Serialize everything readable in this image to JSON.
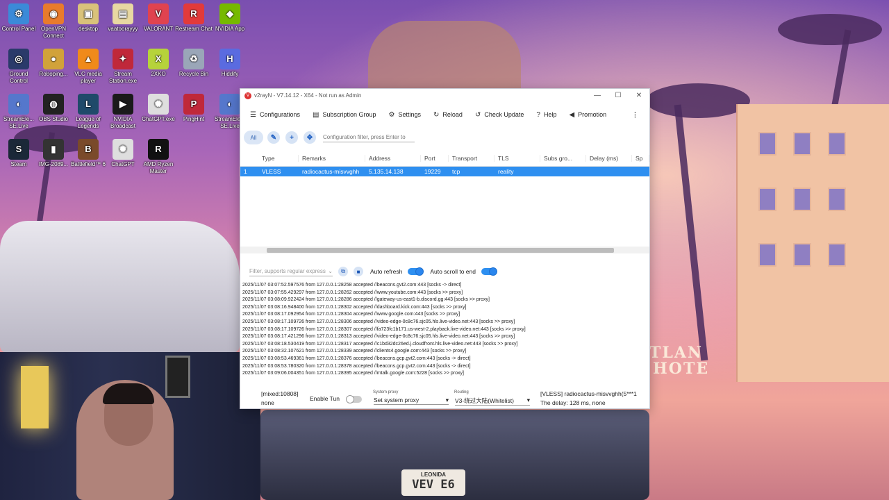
{
  "desktop_icons": [
    {
      "label": "Control Panel",
      "glyph": "⚙",
      "color": "#3b8ad8"
    },
    {
      "label": "OpenVPN Connect",
      "glyph": "◉",
      "color": "#e87b2c"
    },
    {
      "label": "desktop",
      "glyph": "▣",
      "color": "#d9c27a"
    },
    {
      "label": "vaatoorayyy",
      "glyph": "▤",
      "color": "#e8d8a2"
    },
    {
      "label": "VALORANT",
      "glyph": "V",
      "color": "#e0434f"
    },
    {
      "label": "Restream Chat",
      "glyph": "R",
      "color": "#e23a3a"
    },
    {
      "label": "NVIDIA App",
      "glyph": "◆",
      "color": "#76b900"
    },
    {
      "label": "Ground Control",
      "glyph": "◎",
      "color": "#2a3a6a"
    },
    {
      "label": "Roboping...",
      "glyph": "●",
      "color": "#d1a23a"
    },
    {
      "label": "VLC media player",
      "glyph": "▲",
      "color": "#f08a1a"
    },
    {
      "label": "Stream Station.exe",
      "glyph": "✦",
      "color": "#c0283a"
    },
    {
      "label": "2XKO",
      "glyph": "X",
      "color": "#b6d33a"
    },
    {
      "label": "Recycle Bin",
      "glyph": "♻",
      "color": "#9aa6b8"
    },
    {
      "label": "Hiddify",
      "glyph": "H",
      "color": "#5a6be0"
    },
    {
      "label": "StreamEle... SE.Live",
      "glyph": "◐",
      "color": "#5577cc"
    },
    {
      "label": "OBS Studio",
      "glyph": "◍",
      "color": "#222"
    },
    {
      "label": "League of Legends",
      "glyph": "L",
      "color": "#1f4a6a"
    },
    {
      "label": "NVIDIA Broadcast",
      "glyph": "▶",
      "color": "#1a1a1a"
    },
    {
      "label": "ChatGPT.exe",
      "glyph": "✺",
      "color": "#dedede"
    },
    {
      "label": "PingHint",
      "glyph": "P",
      "color": "#c0283a"
    },
    {
      "label": "StreamEle... SE.Live",
      "glyph": "◐",
      "color": "#5577cc"
    },
    {
      "label": "Steam",
      "glyph": "S",
      "color": "#1b2838"
    },
    {
      "label": "IMG-2089...",
      "glyph": "▮",
      "color": "#333"
    },
    {
      "label": "Battlefield™ 6",
      "glyph": "B",
      "color": "#7a4a2a"
    },
    {
      "label": "ChatGPT",
      "glyph": "✺",
      "color": "#dedede"
    },
    {
      "label": "AMD Ryzen Master",
      "glyph": "R",
      "color": "#111"
    }
  ],
  "wallpaper": {
    "sign_line1": "TLAN",
    "sign_line2": "HOTE",
    "plate_top": "LEONIDA",
    "plate": "VEV E6"
  },
  "window": {
    "title": "v2rayN - V7.14.12 - X64 - Not run as Admin",
    "menu": [
      {
        "icon": "menu-icon",
        "glyph": "☰",
        "label": "Configurations"
      },
      {
        "icon": "document-icon",
        "glyph": "▤",
        "label": "Subscription Group"
      },
      {
        "icon": "gear-icon",
        "glyph": "⚙",
        "label": "Settings"
      },
      {
        "icon": "reload-icon",
        "glyph": "↻",
        "label": "Reload"
      },
      {
        "icon": "update-icon",
        "glyph": "↺",
        "label": "Check Update"
      },
      {
        "icon": "help-icon",
        "glyph": "?",
        "label": "Help"
      },
      {
        "icon": "speaker-icon",
        "glyph": "◀",
        "label": "Promotion"
      }
    ],
    "more_glyph": "⋮",
    "toolbar": {
      "all_label": "All",
      "filter_placeholder": "Configuration filter, press Enter to"
    },
    "grid": {
      "columns": [
        "",
        "Type",
        "Remarks",
        "Address",
        "Port",
        "Transport",
        "TLS",
        "Subs gro...",
        "Delay (ms)",
        "Sp"
      ],
      "rows": [
        [
          "1",
          "VLESS",
          "radiocactus-misvvghh",
          "5.135.14.138",
          "19229",
          "tcp",
          "reality",
          "",
          "",
          ""
        ]
      ]
    },
    "logbar": {
      "filter_placeholder": "Filter, supports regular express",
      "auto_refresh_label": "Auto refresh",
      "auto_refresh_on": true,
      "auto_scroll_label": "Auto scroll to end",
      "auto_scroll_on": true
    },
    "logs": [
      "2025/11/07 03:07:52.597576 from 127.0.0.1:28258 accepted //beacons.gvt2.com:443 [socks -> direct]",
      "2025/11/07 03:07:55.429297 from 127.0.0.1:28262 accepted //www.youtube.com:443 [socks >> proxy]",
      "2025/11/07 03:08:09.922424 from 127.0.0.1:28286 accepted //gateway-us-east1-b.discord.gg:443 [socks >> proxy]",
      "2025/11/07 03:08:16.948400 from 127.0.0.1:28302 accepted //dashboard.kick.com:443 [socks >> proxy]",
      "2025/11/07 03:08:17.092954 from 127.0.0.1:28304 accepted //www.google.com:443 [socks >> proxy]",
      "2025/11/07 03:08:17.109726 from 127.0.0.1:28306 accepted //video-edge-0c8c76.sjc05.hls.live-video.net:443 [socks >> proxy]",
      "2025/11/07 03:08:17.109726 from 127.0.0.1:28307 accepted //fa723fc1b171.us-west-2.playback.live-video.net:443 [socks >> proxy]",
      "2025/11/07 03:08:17.421296 from 127.0.0.1:28313 accepted //video-edge-0c8c76.sjc05.hls.live-video.net:443 [socks >> proxy]",
      "2025/11/07 03:08:18.530419 from 127.0.0.1:28317 accepted //c1bd32dc26ed.j.cloudfront.hls.live-video.net:443 [socks >> proxy]",
      "2025/11/07 03:08:32.107621 from 127.0.0.1:28339 accepted //clients4.google.com:443 [socks >> proxy]",
      "2025/11/07 03:08:53.469361 from 127.0.0.1:28376 accepted //beacons.gcp.gvt2.com:443 [socks -> direct]",
      "2025/11/07 03:08:53.780320 from 127.0.0.1:28378 accepted //beacons.gcp.gvt2.com:443 [socks -> direct]",
      "2025/11/07 03:09:06.004351 from 127.0.0.1:28395 accepted //mtalk.google.com:5228 [socks >> proxy]"
    ],
    "status": {
      "mixed": "[mixed:10808]",
      "mode": "none",
      "tun_label": "Enable Tun",
      "tun_on": false,
      "system_proxy_caption": "System proxy",
      "system_proxy_value": "Set system proxy",
      "routing_caption": "Routing",
      "routing_value": "V3-绕过大陆(Whitelist)",
      "server": "[VLESS] radiocactus-misvvghh(5***1",
      "delay": "The delay: 128 ms, none"
    }
  }
}
